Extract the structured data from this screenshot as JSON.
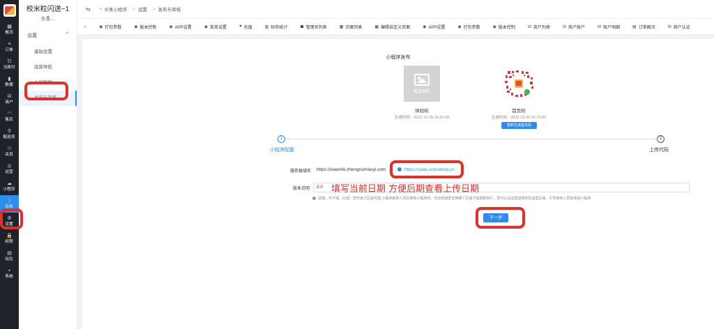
{
  "rail": {
    "items": [
      {
        "icon": "▦",
        "label": "概况"
      },
      {
        "icon": "≡",
        "label": "订单"
      },
      {
        "icon": "☷",
        "label": "当面付"
      },
      {
        "icon": "▮",
        "label": "数据"
      },
      {
        "icon": "⊟",
        "label": "商户"
      },
      {
        "icon": "◠",
        "label": "售后"
      },
      {
        "icon": "⚲",
        "label": "配送员"
      },
      {
        "icon": "⚇",
        "label": "店员"
      },
      {
        "icon": "◎",
        "label": "运营"
      },
      {
        "icon": "☁",
        "label": "小程序"
      },
      {
        "icon": "⁞⁞",
        "label": "应用"
      },
      {
        "icon": "⚙",
        "label": "设置"
      },
      {
        "icon": "🔒",
        "label": "权限"
      },
      {
        "icon": "▤",
        "label": "站位"
      },
      {
        "icon": "▪",
        "label": "系统"
      }
    ]
  },
  "side2": {
    "shop_name": "校米粒闪送~1",
    "shop_sub": "头条...",
    "group_title": "设置",
    "group_arrow": "^",
    "items": [
      "基础设置",
      "底部导航",
      "入口链接",
      "发布与审核"
    ]
  },
  "topbar": {
    "toggle_icon": "⇆",
    "crumbs": [
      "头条小程序",
      "设置",
      "发布与审核"
    ]
  },
  "tabs": {
    "nav_left": "<",
    "items": [
      {
        "icon": "◉",
        "label": "打包参数"
      },
      {
        "icon": "◉",
        "label": "版本控制"
      },
      {
        "icon": "◉",
        "label": "APP设置"
      },
      {
        "icon": "◉",
        "label": "菜单设置"
      },
      {
        "icon": "♥",
        "label": "充值"
      },
      {
        "icon": "▥",
        "label": "财务统计"
      },
      {
        "icon": "☗",
        "label": "管理员列表"
      },
      {
        "icon": "▦",
        "label": "页面列表"
      },
      {
        "icon": "▦",
        "label": "编辑自定义页面"
      },
      {
        "icon": "◉",
        "label": "APP设置"
      },
      {
        "icon": "◉",
        "label": "打包参数"
      },
      {
        "icon": "◉",
        "label": "版本控制"
      },
      {
        "icon": "⊟",
        "label": "商户列表"
      },
      {
        "icon": "⊟",
        "label": "商户账户"
      },
      {
        "icon": "⊟",
        "label": "账户明细"
      },
      {
        "icon": "▤",
        "label": "订单概况"
      },
      {
        "icon": "⊟",
        "label": "商户认证"
      }
    ]
  },
  "publish": {
    "title": "小程序发布",
    "trial": {
      "placeholder_text": "暂无图片",
      "name": "体验码",
      "time": "生成时间：2022-10-25 15:51:00"
    },
    "home": {
      "name": "首页码",
      "time": "生成时间：2022-12-20 22:21:00",
      "regen_label": "重新生成首页码"
    },
    "steps": [
      {
        "num": "1",
        "label": "小程序配置"
      },
      {
        "num": "2",
        "label": "上传代码"
      }
    ],
    "form": {
      "domain_label": "服务器域名",
      "domain_value": "https://xiaomili.zhengruimaoyi.com",
      "domain_extra": "https://saas.schoolrun.cn",
      "version_label": "版本说明",
      "version_value": "3.0",
      "hint": "选填，可不填。比如：您开启了区域代理,小程序审核人员在审核小程序时，无法知道定位到哪个区域才能限制商户，您可以在这里说明你的运营区域，引导审核人员的体验小程序",
      "next_label": "下一步"
    },
    "annotation": "填写当前日期 方便后期查看上传日期"
  },
  "colors": {
    "primary": "#2d8cf0",
    "highlight": "#e62e25",
    "rail_bg": "#1f2329"
  }
}
